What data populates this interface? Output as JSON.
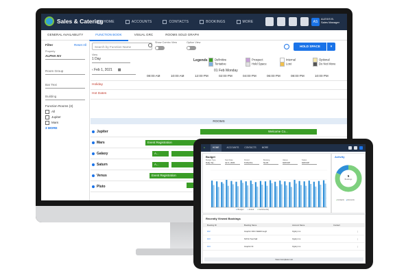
{
  "app": {
    "name": "Sales & Catering",
    "nav": [
      "HOME",
      "ACCOUNTS",
      "CONTACTS",
      "BOOKINGS",
      "MORE"
    ],
    "user_initials": "AS",
    "user_name": "ALEXIS B.",
    "user_role": "Sales Manager"
  },
  "tabs": [
    "GENERAL AVAILABILITY",
    "FUNCTION BOOK",
    "VISUAL GRC",
    "ROOMS SOLD GRAPH"
  ],
  "active_tab": "FUNCTION BOOK",
  "filter": {
    "title": "Filter",
    "reset": "Reset All",
    "property_label": "Property",
    "property_value": "ALPHA NV",
    "room_group_label": "Room Group",
    "bar_text_label": "Bar Text",
    "building_label": "Building",
    "function_rooms_label": "Function Rooms",
    "function_rooms_count": "(3)",
    "room_options": [
      "All",
      "Jupiter",
      "Mars"
    ],
    "more": "3 MORE"
  },
  "toolbar": {
    "search_placeholder": "Search by Function Name",
    "combo_view_label": "Show Combo View",
    "option_view_label": "Option View",
    "hold_space": "HOLD SPACE"
  },
  "grid": {
    "view_label": "View",
    "view_value": "1 Day",
    "legends_title": "Legends",
    "legends": [
      {
        "label": "Definitive",
        "color": "#3a9d26"
      },
      {
        "label": "Tentative",
        "color": "#7fb1e0"
      },
      {
        "label": "Prospect",
        "color": "#c8a0d8"
      },
      {
        "label": "Hold Space",
        "color": "#e0e0e0"
      },
      {
        "label": "Internal",
        "color": "#ffffff"
      },
      {
        "label": "Lost",
        "color": "#f2c14e"
      },
      {
        "label": "Optional",
        "color": "#f5e6a8"
      },
      {
        "label": "Do Not Move",
        "color": "#555555"
      }
    ],
    "date": "Feb 1, 2021",
    "date_heading": "01 Feb Monday",
    "times": [
      "08:00 AM",
      "10:00 AM",
      "12:00 PM",
      "02:00 PM",
      "04:00 PM",
      "06:00 PM",
      "08:00 PM",
      "10:00 PM"
    ],
    "holiday": "Holiday",
    "hot_dates": "Hot Dates",
    "rooms_band": "ROOMS",
    "rooms": [
      "Jupiter",
      "Mars",
      "Galaxy",
      "Saturn",
      "Venus",
      "Pluto"
    ],
    "events": {
      "jupiter": "Welcome Co...",
      "mars": "Event Registration",
      "galaxy_a": "A...",
      "saturn_a": "A...",
      "venus": "Event Registration"
    }
  },
  "tablet": {
    "nav": [
      "HOME",
      "ACCOUNTS",
      "CONTACTS",
      "MORE"
    ],
    "budget_title": "Budget",
    "budget_filters": [
      {
        "label": "Budget Type",
        "value": "Daily Sa..."
      },
      {
        "label": "Start Date",
        "value": "Jul 3, 2021"
      },
      {
        "label": "Period",
        "value": "6 Months"
      },
      {
        "label": "Booking",
        "value": "North"
      },
      {
        "label": "Values",
        "value": "GROUP"
      },
      {
        "label": "Status",
        "value": "GROUP"
      }
    ],
    "budget_legend": [
      "Budget",
      "Actual",
      "Definite/Adj"
    ],
    "activity_title": "Activity",
    "activity_center_value": "5",
    "activity_center_label": "Bookings",
    "activity_legend": [
      "Contacts",
      "Accounts"
    ],
    "recent_title": "Recently Viewed Bookings",
    "recent_headers": [
      "Booking ID",
      "Booking Name",
      "Account Name",
      "Contact"
    ],
    "recent_rows": [
      {
        "id": "102",
        "name": "Graphic 2021 Walkthrough",
        "account": "Ogilvy Inc."
      },
      {
        "id": "103",
        "name": "NOVA Townhall",
        "account": "Ogilvy Inc."
      },
      {
        "id": "104",
        "name": "Graphic ID",
        "account": "Ogilvy Inc."
      }
    ],
    "view_all": "View Complete List"
  },
  "chart_data": {
    "type": "bar",
    "title": "Budget",
    "series": [
      {
        "name": "Budget",
        "values": [
          72,
          70,
          68,
          74,
          71,
          69,
          73,
          70,
          72,
          68,
          71,
          70,
          73,
          69,
          72,
          70,
          68,
          74,
          71,
          70,
          72,
          69,
          71,
          73
        ]
      },
      {
        "name": "Actual",
        "values": [
          60,
          55,
          64,
          58,
          62,
          57,
          66,
          59,
          63,
          56,
          61,
          58,
          65,
          57,
          62,
          59,
          55,
          64,
          60,
          58,
          63,
          56,
          61,
          64
        ]
      }
    ],
    "ylim": [
      0,
      100
    ]
  },
  "donut": {
    "values": [
      82,
      18
    ],
    "colors": [
      "#7ed07e",
      "#2f8fd8"
    ]
  }
}
